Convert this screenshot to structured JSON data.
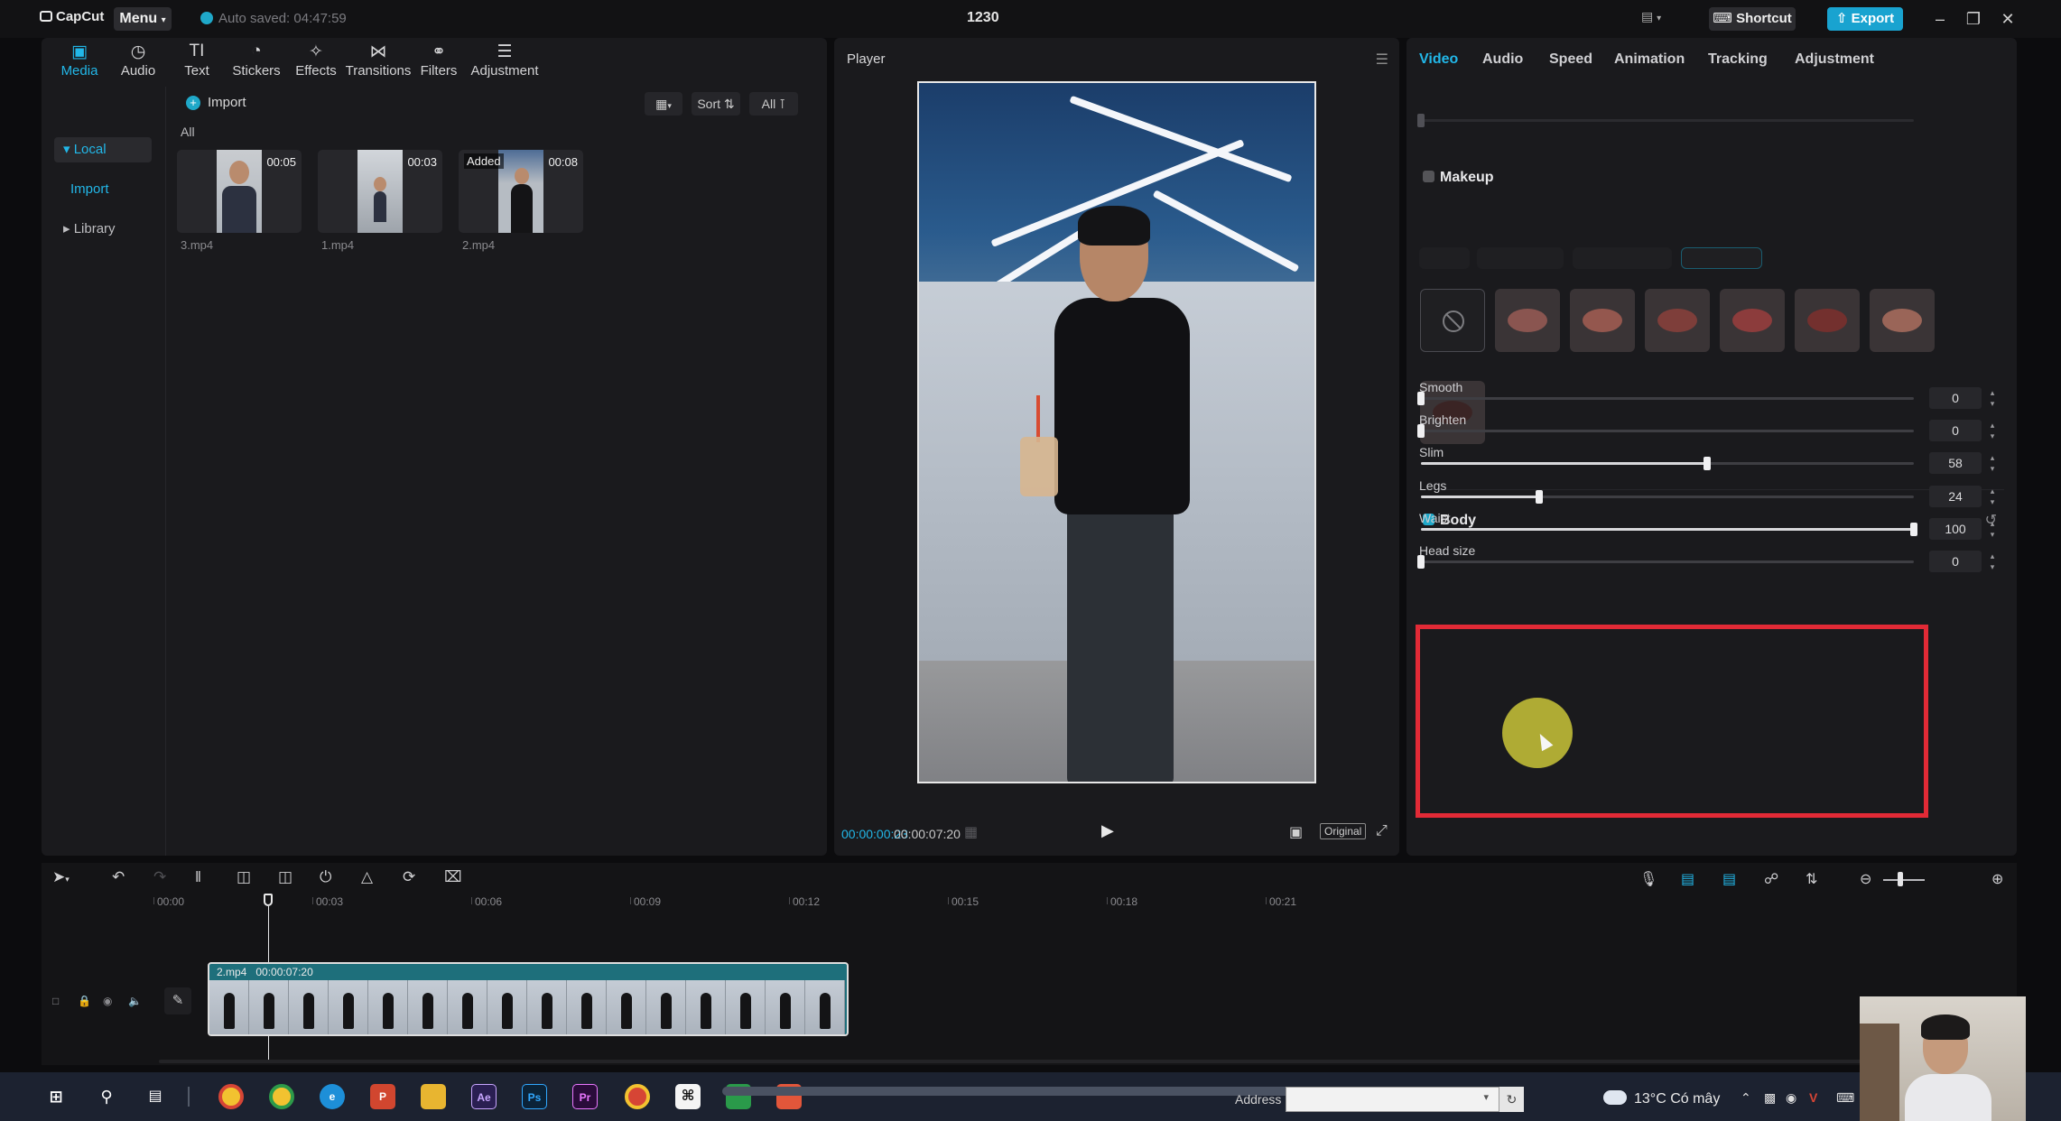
{
  "app": {
    "logo": "CapCut",
    "menu_label": "Menu",
    "autosave": "Auto saved: 04:47:59",
    "project_name": "1230",
    "shortcut_label": "Shortcut",
    "export_label": "Export",
    "accent_color": "#22b7e8"
  },
  "toolbar": {
    "tabs": [
      {
        "label": "Media",
        "icon": "media-icon",
        "active": true
      },
      {
        "label": "Audio",
        "icon": "audio-icon"
      },
      {
        "label": "Text",
        "icon": "text-icon"
      },
      {
        "label": "Stickers",
        "icon": "sticker-icon"
      },
      {
        "label": "Effects",
        "icon": "effects-icon"
      },
      {
        "label": "Transitions",
        "icon": "transitions-icon"
      },
      {
        "label": "Filters",
        "icon": "filters-icon"
      },
      {
        "label": "Adjustment",
        "icon": "adjustment-icon"
      }
    ]
  },
  "media": {
    "sidebar": {
      "local": "Local",
      "import": "Import",
      "library": "Library"
    },
    "import_label": "Import",
    "sort_label": "Sort",
    "all_filter": "All",
    "all_heading": "All",
    "clips": [
      {
        "name": "3.mp4",
        "duration": "00:05",
        "added": ""
      },
      {
        "name": "1.mp4",
        "duration": "00:03",
        "added": ""
      },
      {
        "name": "2.mp4",
        "duration": "00:08",
        "added": "Added"
      }
    ]
  },
  "player": {
    "title": "Player",
    "current_time": "00:00:00:23",
    "total_time": "00:00:07:20",
    "original_label": "Original"
  },
  "inspector": {
    "tabs": [
      {
        "label": "Video",
        "active": true
      },
      {
        "label": "Audio"
      },
      {
        "label": "Speed"
      },
      {
        "label": "Animation"
      },
      {
        "label": "Tracking"
      },
      {
        "label": "Adjustment"
      }
    ],
    "makeup": {
      "title": "Makeup",
      "checked": false
    },
    "body": {
      "title": "Body",
      "checked": true,
      "sliders": [
        {
          "label": "Smooth",
          "value": "0",
          "level": 0
        },
        {
          "label": "Brighten",
          "value": "0",
          "level": 0
        },
        {
          "label": "Slim",
          "value": "58",
          "level": 58
        },
        {
          "label": "Legs",
          "value": "24",
          "level": 24
        },
        {
          "label": "Waist",
          "value": "100",
          "level": 100
        },
        {
          "label": "Head size",
          "value": "0",
          "level": 0
        }
      ]
    }
  },
  "timeline": {
    "ruler": [
      "00:00",
      "00:03",
      "00:06",
      "00:09",
      "00:12",
      "00:15",
      "00:18",
      "00:21"
    ],
    "clip": {
      "name": "2.mp4",
      "duration": "00:00:07:20"
    }
  },
  "taskbar": {
    "address_label": "Address",
    "weather": "13°C Có mây",
    "apps": [
      "chrome-icon",
      "chrome-icon",
      "edge-icon",
      "powerpoint-icon",
      "folder-icon",
      "after-effects-icon",
      "photoshop-icon",
      "premiere-icon",
      "chrome-profile-icon",
      "capcut-icon",
      "green-app-icon",
      "red-app-icon"
    ]
  }
}
